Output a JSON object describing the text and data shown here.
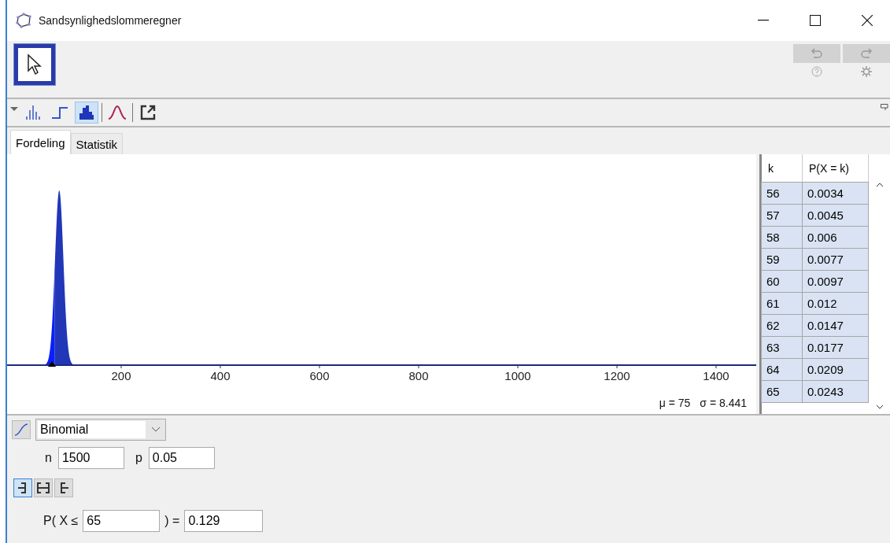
{
  "window": {
    "title": "Sandsynlighedslommeregner"
  },
  "view_buttons": [
    {
      "kind": "bars",
      "selected": false
    },
    {
      "kind": "step",
      "selected": false
    },
    {
      "kind": "histogram",
      "selected": true
    },
    {
      "kind": "normal",
      "selected": false
    },
    {
      "kind": "export",
      "selected": false
    }
  ],
  "tabs": [
    {
      "label": "Fordeling",
      "selected": true
    },
    {
      "label": "Statistik",
      "selected": false
    }
  ],
  "plot": {
    "x_axis_labels": [
      "200",
      "400",
      "600",
      "800",
      "1000",
      "1200",
      "1400"
    ],
    "mean": "μ = 75",
    "sd": "σ = 8.441"
  },
  "table": {
    "columns": [
      "k",
      "P(X = k)"
    ],
    "rows": [
      [
        "56",
        "0.0034"
      ],
      [
        "57",
        "0.0045"
      ],
      [
        "58",
        "0.006"
      ],
      [
        "59",
        "0.0077"
      ],
      [
        "60",
        "0.0097"
      ],
      [
        "61",
        "0.012"
      ],
      [
        "62",
        "0.0147"
      ],
      [
        "63",
        "0.0177"
      ],
      [
        "64",
        "0.0209"
      ],
      [
        "65",
        "0.0243"
      ]
    ]
  },
  "distribution": {
    "name": "Binomial"
  },
  "parameters": [
    {
      "label": "n",
      "value": "1500"
    },
    {
      "label": "p",
      "value": "0.05"
    }
  ],
  "interval_buttons": [
    {
      "kind": "left",
      "selected": true
    },
    {
      "kind": "two",
      "selected": false
    },
    {
      "kind": "right",
      "selected": false
    }
  ],
  "probability": {
    "prefix": "P( X ≤",
    "bound": "65",
    "suffix": ") =",
    "result": "0.129"
  }
}
